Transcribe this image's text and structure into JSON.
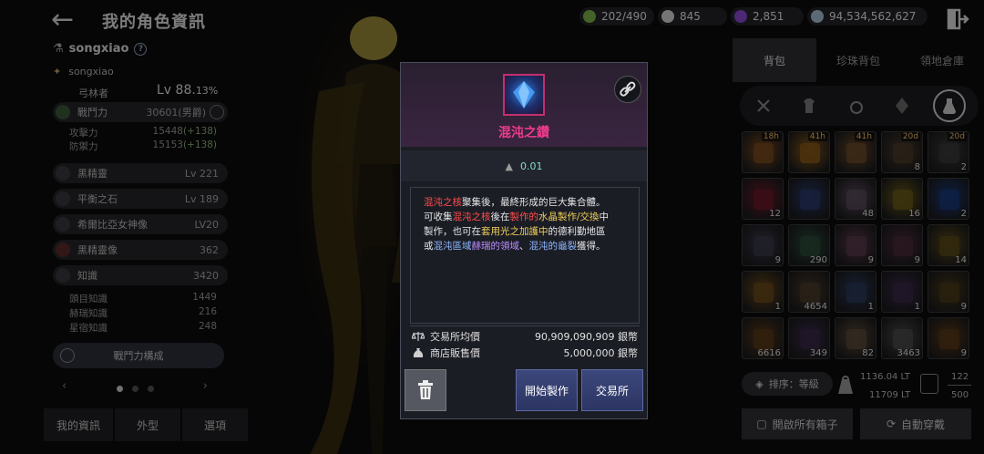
{
  "header": {
    "title": "我的角色資訊",
    "resources": [
      {
        "value": "202/490",
        "color": "#7fb54a"
      },
      {
        "value": "845",
        "color": "#d7d7d7"
      },
      {
        "value": "2,851",
        "color": "#8a4ad6"
      },
      {
        "value": "94,534,562,627",
        "color": "#a8c2d8"
      }
    ]
  },
  "left": {
    "character_name": "songxiao",
    "family_name": "songxiao",
    "class_name": "弓林者",
    "level": "Lv 88.",
    "level_pct": "13%",
    "combat": {
      "label": "戰鬥力",
      "value": "30601(男爵)"
    },
    "attack": {
      "label": "攻擊力",
      "base": "15448",
      "bonus": "(+138)"
    },
    "defense": {
      "label": "防禦力",
      "base": "15153",
      "bonus": "(+138)"
    },
    "stats": [
      {
        "label": "黑精靈",
        "value": "Lv 221"
      },
      {
        "label": "平衡之石",
        "value": "Lv 189"
      },
      {
        "label": "希爾比亞女神像",
        "value": "LV20"
      },
      {
        "label": "黑精靈像",
        "value": "362"
      },
      {
        "label": "知識",
        "value": "3420"
      }
    ],
    "knowledge_subs": [
      {
        "label": "頭目知識",
        "value": "1449"
      },
      {
        "label": "赫瑞知識",
        "value": "216"
      },
      {
        "label": "星宿知識",
        "value": "248"
      }
    ],
    "cp_button": "戰鬥力構成",
    "tabs": [
      "我的資訊",
      "外型",
      "選項"
    ]
  },
  "inventory": {
    "tabs": [
      "背包",
      "珍珠背包",
      "領地倉庫"
    ],
    "sort_label": "排序：等級",
    "weight_current": "1136.04 LT",
    "weight_max": "11709 LT",
    "slots_used": "122",
    "slots_max": "500",
    "open_boxes": "開啟所有箱子",
    "auto_equip": "自動穿戴",
    "slots": [
      {
        "count": "",
        "timer": "18h",
        "color": "#7a4a1e"
      },
      {
        "count": "",
        "timer": "41h",
        "color": "#8a5a1a"
      },
      {
        "count": "",
        "timer": "41h",
        "color": "#6a4a2a"
      },
      {
        "count": "8",
        "timer": "20d",
        "color": "#4a3a2a"
      },
      {
        "count": "2",
        "timer": "20d",
        "color": "#3a3a3a"
      },
      {
        "count": "12",
        "timer": "",
        "color": "#6a1a2a"
      },
      {
        "count": "",
        "timer": "",
        "color": "#2a3a6a"
      },
      {
        "count": "48",
        "timer": "",
        "color": "#5a4a5a"
      },
      {
        "count": "16",
        "timer": "",
        "color": "#6a5a1a"
      },
      {
        "count": "2",
        "timer": "",
        "color": "#1a3a7a"
      },
      {
        "count": "9",
        "timer": "",
        "color": "#3a3a4a"
      },
      {
        "count": "290",
        "timer": "",
        "color": "#2a4a3a"
      },
      {
        "count": "9",
        "timer": "",
        "color": "#5a3a4a"
      },
      {
        "count": "9",
        "timer": "",
        "color": "#4a2a3a"
      },
      {
        "count": "14",
        "timer": "",
        "color": "#5a4a1a"
      },
      {
        "count": "1",
        "timer": "",
        "color": "#6a4a1a"
      },
      {
        "count": "4654",
        "timer": "",
        "color": "#4a3a2a"
      },
      {
        "count": "1",
        "timer": "",
        "color": "#2a3a5a"
      },
      {
        "count": "1",
        "timer": "",
        "color": "#3a2a4a"
      },
      {
        "count": "9",
        "timer": "",
        "color": "#4a3a1a"
      },
      {
        "count": "6616",
        "timer": "",
        "color": "#5a3a1a"
      },
      {
        "count": "349",
        "timer": "",
        "color": "#3a2a4a"
      },
      {
        "count": "82",
        "timer": "",
        "color": "#5a4a3a"
      },
      {
        "count": "3463",
        "timer": "",
        "color": "#4a4a4a"
      },
      {
        "count": "9",
        "timer": "",
        "color": "#5a3a1a"
      }
    ]
  },
  "modal": {
    "item_name": "混沌之鑽",
    "weight": "0.01",
    "desc": {
      "p1_a": "混沌之核",
      "p1_b": "聚集後，最終形成的巨大集合體。",
      "p2_a": "可收集",
      "p2_b": "混沌之核",
      "p2_c": "後在",
      "p2_d": "製作的",
      "p2_e": "水晶製作/交換",
      "p2_f": "中",
      "p3_a": "製作，也可在",
      "p3_b": "套用光之加護中",
      "p3_c": "的德利勤地區",
      "p4_a": "或",
      "p4_b": "混沌區域",
      "p4_c": "赫瑞的領域",
      "p4_d": "、",
      "p4_e": "混沌的龜裂",
      "p4_f": "獲得。"
    },
    "market_label": "交易所均價",
    "market_value": "90,909,090,909 銀幣",
    "shop_label": "商店販售價",
    "shop_value": "5,000,000 銀幣",
    "craft_button": "開始製作",
    "exchange_button": "交易所"
  }
}
